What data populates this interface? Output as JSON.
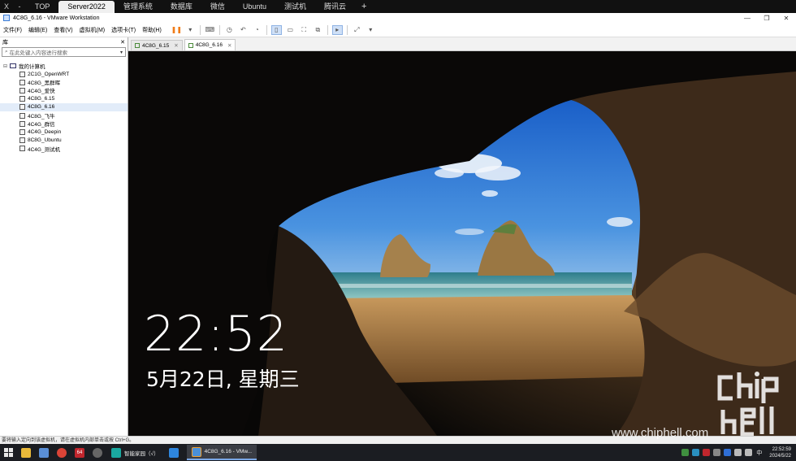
{
  "top_tabs": {
    "close_icon": "X",
    "minimize_icon": "-",
    "tabs": [
      "TOP",
      "Server2022",
      "管理系统",
      "数据库",
      "微信",
      "Ubuntu",
      "测试机",
      "腾讯云"
    ],
    "active_index": 1,
    "add_icon": "+"
  },
  "window": {
    "title": "4C8G_6.16 - VMware Workstation",
    "minimize": "—",
    "restore": "❐",
    "close": "✕"
  },
  "menu": {
    "items": [
      "文件(F)",
      "编辑(E)",
      "查看(V)",
      "虚拟机(M)",
      "选项卡(T)",
      "帮助(H)"
    ]
  },
  "library": {
    "title": "库",
    "close_icon": "✕",
    "search_placeholder": "在此处键入内容进行搜索",
    "root_label": "我的计算机",
    "vms": [
      "2C1G_OpenWRT",
      "4C8G_黑群晖",
      "4C4G_爱快",
      "4C8G_6.15",
      "4C8G_6.16",
      "4C8G_飞牛",
      "4C4G_群信",
      "4C4G_Deepin",
      "8C8G_Ubuntu",
      "4C4G_测试机"
    ],
    "selected_index": 4
  },
  "vm_tabs": {
    "tabs": [
      "4C8G_6.15",
      "4C8G_6.16"
    ],
    "active_index": 1,
    "close_icon": "✕"
  },
  "lockscreen": {
    "time": "22:52",
    "date": "5月22日, 星期三"
  },
  "statusbar": {
    "text": "要将输入定向到该虚拟机，请在虚拟机内部单击或按 Ctrl+G。"
  },
  "watermark": {
    "url": "www.chiphell.com"
  },
  "taskbar": {
    "apps": [
      {
        "label": "智能家园（√）",
        "icon": "home-assistant-icon"
      },
      {
        "label": "",
        "icon": "k-app-icon"
      },
      {
        "label": "4C8G_6.16 - VMw...",
        "icon": "vmware-icon"
      }
    ],
    "tray_lang": "中",
    "time": "22:52:59",
    "date": "2024/5/22"
  }
}
